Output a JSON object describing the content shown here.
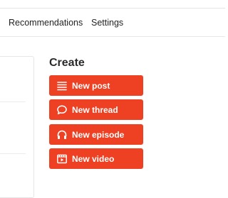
{
  "nav": {
    "tabs": [
      {
        "label": "Recommendations"
      },
      {
        "label": "Settings"
      }
    ]
  },
  "create": {
    "title": "Create",
    "buttons": [
      {
        "label": "New post",
        "icon": "list-icon"
      },
      {
        "label": "New thread",
        "icon": "speech-bubble-icon"
      },
      {
        "label": "New episode",
        "icon": "headphones-icon"
      },
      {
        "label": "New video",
        "icon": "video-icon"
      }
    ]
  },
  "colors": {
    "accent": "#ee4023"
  }
}
